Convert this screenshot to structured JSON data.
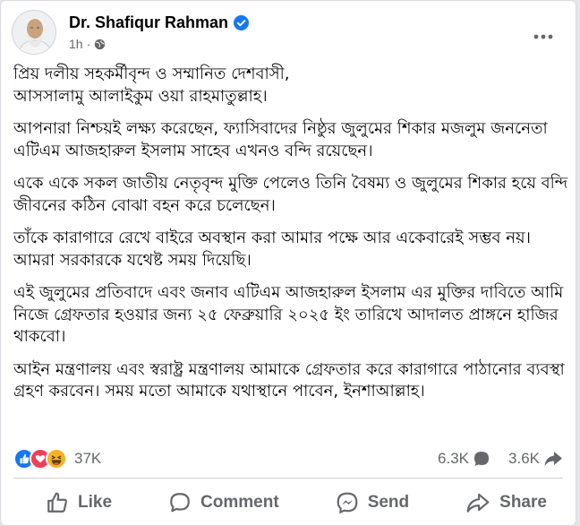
{
  "post": {
    "author": "Dr. Shafiqur Rahman",
    "time": "1h",
    "time_separator": "·",
    "audience_icon": "globe-icon",
    "paragraphs": [
      "প্রিয় দলীয় সহকর্মীবৃন্দ ও সম্মানিত দেশবাসী,\nআসসালামু আলাইকুম ওয়া রাহমাতুল্লাহ।",
      "আপনারা নিশ্চয়ই লক্ষ্য করেছেন, ফ্যাসিবাদের নিষ্ঠুর জুলুমের শিকার মজলুম জননেতা এটিএম আজহারুল ইসলাম সাহেব এখনও বন্দি রয়েছেন।",
      "একে একে সকল জাতীয় নেতৃবৃন্দ মুক্তি পেলেও তিনি বৈষম্য ও জুলুমের শিকার হয়ে বন্দি জীবনের কঠিন বোঝা বহন করে চলেছেন।",
      "তাঁকে কারাগারে রেখে বাইরে অবস্থান করা আমার পক্ষে আর একেবারেই সম্ভব নয়। আমরা সরকারকে যথেষ্ট সময় দিয়েছি।",
      "এই জুলুমের প্রতিবাদে এবং জনাব এটিএম আজহারুল ইসলাম এর মুক্তির দাবিতে আমি নিজে গ্রেফতার হওয়ার জন্য ২৫ ফেব্রুয়ারি ২০২৫ ইং তারিখে আদালত প্রাঙ্গনে হাজির থাকবো।",
      "আইন মন্ত্রণালয় এবং স্বরাষ্ট্র মন্ত্রণালয় আমাকে গ্রেফতার করে কারাগারে পাঠানোর ব্যবস্থা গ্রহণ করবেন। সময় মতো আমাকে যথাস্থানে পাবেন, ইনশাআল্লাহ।"
    ]
  },
  "stats": {
    "reactions_count": "37K",
    "comments_count": "6.3K",
    "shares_count": "3.6K",
    "reaction_icons": [
      "like-icon",
      "love-icon",
      "haha-icon"
    ]
  },
  "actions": {
    "like": "Like",
    "comment": "Comment",
    "send": "Send",
    "share": "Share"
  },
  "colors": {
    "brand_blue": "#1877f2",
    "love_red": "#f33e58",
    "haha_yellow": "#f7b125",
    "secondary_text": "#65676b"
  }
}
